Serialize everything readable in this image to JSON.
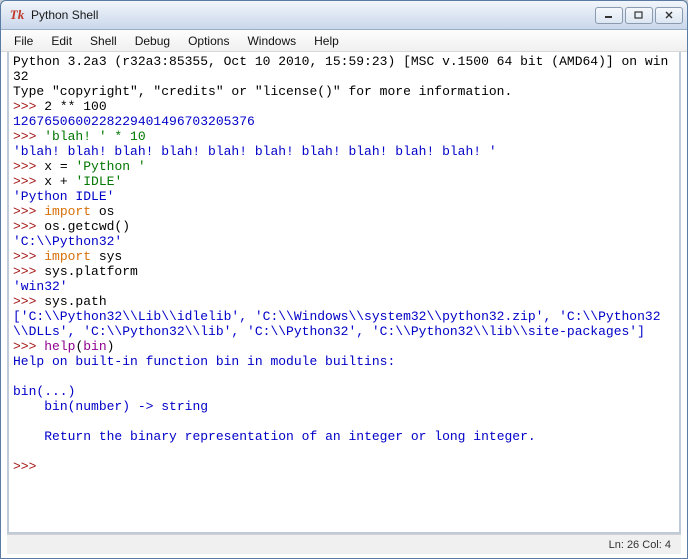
{
  "title": "Python Shell",
  "menu": {
    "file": "File",
    "edit": "Edit",
    "shell": "Shell",
    "debug": "Debug",
    "options": "Options",
    "windows": "Windows",
    "help": "Help"
  },
  "banner_line1": "Python 3.2a3 (r32a3:85355, Oct 10 2010, 15:59:23) [MSC v.1500 64 bit (AMD64)] on win32",
  "banner_line2": "Type \"copyright\", \"credits\" or \"license()\" for more information.",
  "prompt": ">>> ",
  "lines": {
    "in1": "2 ** 100",
    "out1": "1267650600228229401496703205376",
    "in2": "'blah! ' * 10",
    "out2": "'blah! blah! blah! blah! blah! blah! blah! blah! blah! blah! '",
    "in3a": "x = ",
    "in3b": "'Python '",
    "in4a": "x + ",
    "in4b": "'IDLE'",
    "out4": "'Python IDLE'",
    "in5a": "import",
    "in5b": " os",
    "in6": "os.getcwd()",
    "out6": "'C:\\\\Python32'",
    "in7a": "import",
    "in7b": " sys",
    "in8": "sys.platform",
    "out8": "'win32'",
    "in9": "sys.path",
    "out9": "['C:\\\\Python32\\\\Lib\\\\idlelib', 'C:\\\\Windows\\\\system32\\\\python32.zip', 'C:\\\\Python32\\\\DLLs', 'C:\\\\Python32\\\\lib', 'C:\\\\Python32', 'C:\\\\Python32\\\\lib\\\\site-packages']",
    "in10a": "help",
    "in10b": "(",
    "in10c": "bin",
    "in10d": ")",
    "help1": "Help on built-in function bin in module builtins:",
    "help2": "",
    "help3": "bin(...)",
    "help4": "    bin(number) -> string",
    "help5": "",
    "help6": "    Return the binary representation of an integer or long integer.",
    "help7": ""
  },
  "status": {
    "ln": "Ln: 26",
    "col": "Col: 4"
  }
}
